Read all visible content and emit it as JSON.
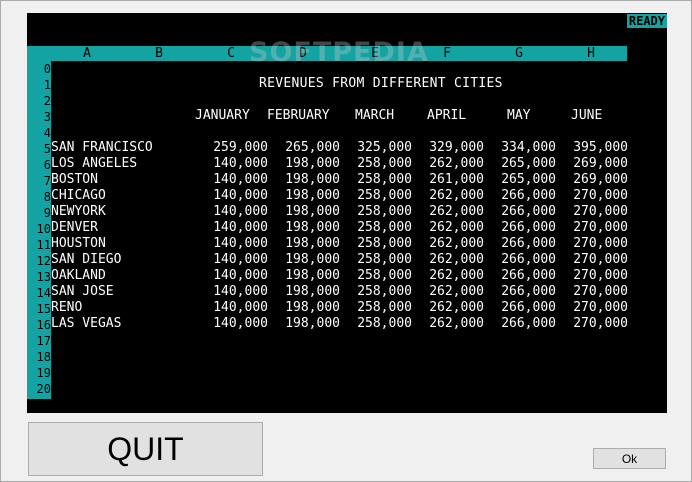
{
  "status": "READY",
  "watermark": "SOFTPEDIA",
  "column_letters": [
    "A",
    "B",
    "C",
    "D",
    "E",
    "F",
    "G",
    "H"
  ],
  "row_numbers": [
    "0",
    "1",
    "2",
    "3",
    "4",
    "5",
    "6",
    "7",
    "8",
    "9",
    "10",
    "11",
    "12",
    "13",
    "14",
    "15",
    "16",
    "17",
    "18",
    "19",
    "20"
  ],
  "sheet": {
    "title": "REVENUES FROM DIFFERENT CITIES",
    "months": [
      "JANUARY",
      "FEBRUARY",
      "MARCH",
      "APRIL",
      "MAY",
      "JUNE"
    ],
    "rows": [
      {
        "city": "SAN FRANCISCO",
        "values": [
          "259,000",
          "265,000",
          "325,000",
          "329,000",
          "334,000",
          "395,000"
        ]
      },
      {
        "city": "LOS ANGELES",
        "values": [
          "140,000",
          "198,000",
          "258,000",
          "262,000",
          "265,000",
          "269,000"
        ]
      },
      {
        "city": "BOSTON",
        "values": [
          "140,000",
          "198,000",
          "258,000",
          "261,000",
          "265,000",
          "269,000"
        ]
      },
      {
        "city": "CHICAGO",
        "values": [
          "140,000",
          "198,000",
          "258,000",
          "262,000",
          "266,000",
          "270,000"
        ]
      },
      {
        "city": "NEWYORK",
        "values": [
          "140,000",
          "198,000",
          "258,000",
          "262,000",
          "266,000",
          "270,000"
        ]
      },
      {
        "city": "DENVER",
        "values": [
          "140,000",
          "198,000",
          "258,000",
          "262,000",
          "266,000",
          "270,000"
        ]
      },
      {
        "city": "HOUSTON",
        "values": [
          "140,000",
          "198,000",
          "258,000",
          "262,000",
          "266,000",
          "270,000"
        ]
      },
      {
        "city": "SAN DIEGO",
        "values": [
          "140,000",
          "198,000",
          "258,000",
          "262,000",
          "266,000",
          "270,000"
        ]
      },
      {
        "city": "OAKLAND",
        "values": [
          "140,000",
          "198,000",
          "258,000",
          "262,000",
          "266,000",
          "270,000"
        ]
      },
      {
        "city": "SAN JOSE",
        "values": [
          "140,000",
          "198,000",
          "258,000",
          "262,000",
          "266,000",
          "270,000"
        ]
      },
      {
        "city": "RENO",
        "values": [
          "140,000",
          "198,000",
          "258,000",
          "262,000",
          "266,000",
          "270,000"
        ]
      },
      {
        "city": "LAS VEGAS",
        "values": [
          "140,000",
          "198,000",
          "258,000",
          "262,000",
          "266,000",
          "270,000"
        ]
      }
    ]
  },
  "buttons": {
    "quit": "QUIT",
    "ok": "Ok"
  },
  "colors": {
    "screen_bg": "#000000",
    "header_bar": "#13a3a3",
    "text": "#ffffff",
    "window_bg": "#f0f0f0"
  }
}
